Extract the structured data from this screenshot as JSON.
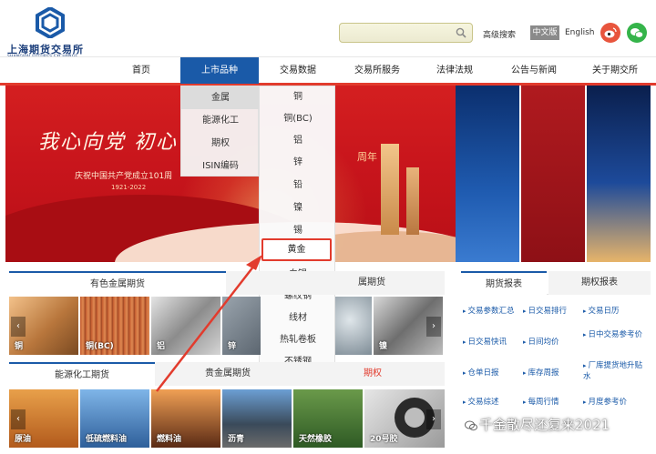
{
  "header": {
    "logo_cn": "上海期货交易所",
    "logo_en": "SHANGHAI FUTURES EXCHANGE",
    "search_placeholder": "",
    "advanced_search": "高级搜索",
    "lang_cn": "中文版",
    "lang_en": "English"
  },
  "nav": {
    "items": [
      "首页",
      "上市品种",
      "交易数据",
      "交易所服务",
      "法律法规",
      "公告与新闻",
      "关于期交所"
    ],
    "active": "上市品种"
  },
  "banner": {
    "slogan": "我心向党 初心",
    "sub": "庆祝中国共产党成立101周",
    "years": "1921-2022",
    "zhou": "周年"
  },
  "dropdown_l1": [
    "金属",
    "能源化工",
    "期权",
    "ISIN编码"
  ],
  "dropdown_l2": [
    "铜",
    "铜(BC)",
    "铝",
    "锌",
    "铅",
    "镍",
    "锡",
    "黄金",
    "白银",
    "螺纹钢",
    "线材",
    "热轧卷板",
    "不锈钢"
  ],
  "dropdown_highlight": "黄金",
  "panel1": {
    "tab_active": "有色金属期货",
    "tab_other": "属期货",
    "thumbs": [
      "铜",
      "铜(BC)",
      "铝",
      "锌",
      "",
      "镍"
    ]
  },
  "panel2": {
    "tabs": [
      "能源化工期货",
      "贵金属期货",
      "期权"
    ],
    "thumbs": [
      "原油",
      "低硫燃料油",
      "燃料油",
      "沥青",
      "天然橡胶",
      "20号胶"
    ]
  },
  "right_panel": {
    "tabs": [
      "期货报表",
      "期权报表"
    ],
    "rows": [
      [
        "交易参数汇总",
        "日交易排行",
        "交易日历"
      ],
      [
        "日交易快讯",
        "日间均价",
        "日中交易参考价"
      ],
      [
        "仓单日报",
        "库存周报",
        "厂库提货地升贴水"
      ],
      [
        "交易综述",
        "每周行情",
        "月度参考价"
      ]
    ]
  },
  "watermark": "千金散尽还复来2021",
  "colors": {
    "brand_blue": "#1a5aa8",
    "nav_red": "#e23b2d",
    "highlight_red": "#e23b2d"
  }
}
